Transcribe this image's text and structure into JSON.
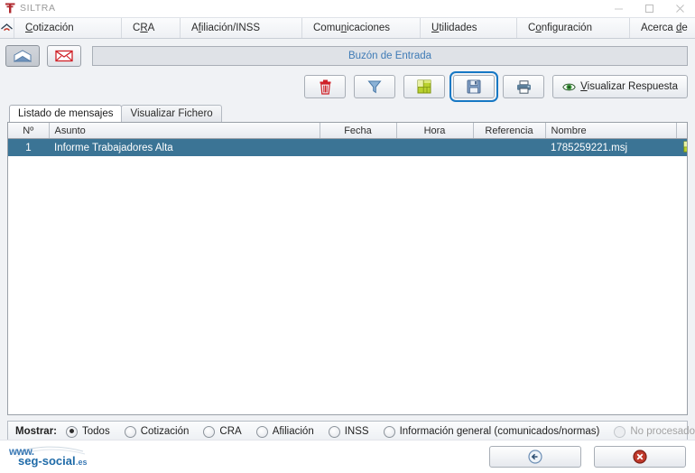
{
  "window": {
    "title": "SILTRA",
    "app_icon": "siltra-logo-icon",
    "controls": [
      {
        "name": "minimize-button",
        "glyph": "minimize-icon"
      },
      {
        "name": "maximize-button",
        "glyph": "maximize-icon"
      },
      {
        "name": "close-button",
        "glyph": "close-icon"
      }
    ]
  },
  "menubar": {
    "home_icon": "home-icon",
    "items": [
      {
        "label": "Cotización",
        "mnemonic": "C"
      },
      {
        "label": "CRA",
        "mnemonic": "R"
      },
      {
        "label": "Afiliación/INSS",
        "mnemonic": "f"
      },
      {
        "label": "Comunicaciones",
        "mnemonic": "n"
      },
      {
        "label": "Utilidades",
        "mnemonic": "U"
      },
      {
        "label": "Configuración",
        "mnemonic": "o"
      },
      {
        "label": "Acerca de",
        "mnemonic": "d"
      }
    ]
  },
  "toolbar": {
    "inbox_button": {
      "name": "inbox-open-envelope-button",
      "icon": "envelope-open-icon",
      "selected": true
    },
    "mail_button": {
      "name": "new-message-button",
      "icon": "envelope-closed-icon",
      "selected": false
    },
    "address_label": "Buzón de Entrada"
  },
  "actions": [
    {
      "name": "delete-button",
      "icon": "trash-icon",
      "label": ""
    },
    {
      "name": "filter-button",
      "icon": "funnel-icon",
      "label": ""
    },
    {
      "name": "export-excel-button",
      "icon": "spreadsheet-icon",
      "label": ""
    },
    {
      "name": "save-button",
      "icon": "floppy-disk-icon",
      "label": "",
      "focused": true
    },
    {
      "name": "print-button",
      "icon": "printer-icon",
      "label": ""
    },
    {
      "name": "view-response-button",
      "icon": "eye-icon",
      "label": "Visualizar Respuesta",
      "mnemonic": "V"
    }
  ],
  "tabs": [
    {
      "label": "Listado de mensajes",
      "active": true
    },
    {
      "label": "Visualizar Fichero",
      "active": false
    }
  ],
  "table": {
    "columns": [
      "Nº",
      "Asunto",
      "Fecha",
      "Hora",
      "Referencia",
      "Nombre",
      ""
    ],
    "rows": [
      {
        "num": "1",
        "asunto": "Informe Trabajadores Alta",
        "fecha": "",
        "hora": "",
        "referencia": "",
        "nombre": "1785259221.msj",
        "action_icon": "spreadsheet-icon",
        "selected": true
      }
    ]
  },
  "filter": {
    "label": "Mostrar:",
    "options": [
      {
        "label": "Todos",
        "selected": true,
        "disabled": false
      },
      {
        "label": "Cotización",
        "selected": false,
        "disabled": false
      },
      {
        "label": "CRA",
        "selected": false,
        "disabled": false
      },
      {
        "label": "Afiliación",
        "selected": false,
        "disabled": false
      },
      {
        "label": "INSS",
        "selected": false,
        "disabled": false
      },
      {
        "label": "Información general (comunicados/normas)",
        "selected": false,
        "disabled": false
      },
      {
        "label": "No procesados",
        "selected": false,
        "disabled": true
      }
    ]
  },
  "footer": {
    "logo_www": "www.",
    "logo_name": "seg-social",
    "logo_tld": ".es",
    "buttons": [
      {
        "name": "back-button",
        "icon": "back-arrow-icon"
      },
      {
        "name": "close-window-button",
        "icon": "cancel-icon"
      }
    ]
  },
  "colors": {
    "accent_blue": "#3b7495",
    "link_blue": "#3f7bb6",
    "focus_blue": "#1778c4",
    "danger_red": "#cf2027",
    "logo_red": "#b02a2f",
    "green": "#7fb800"
  }
}
